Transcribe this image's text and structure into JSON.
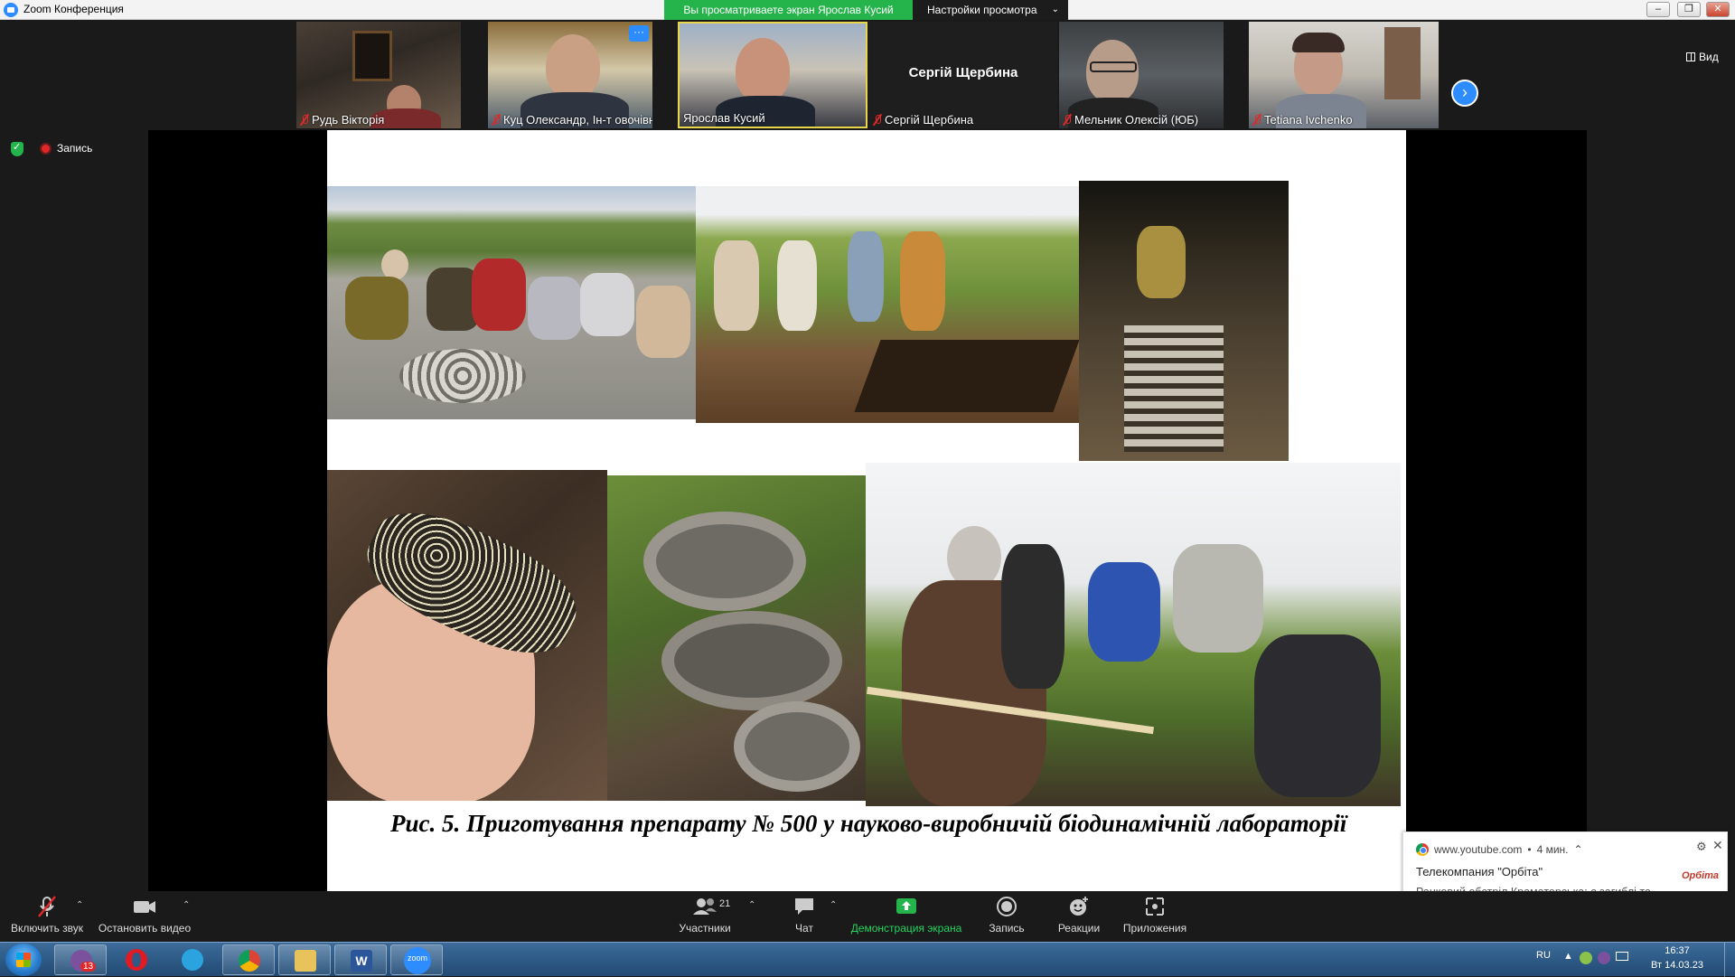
{
  "window": {
    "title": "Zoom Конференция",
    "share_banner": "Вы просматриваете экран Ярослав Кусий",
    "view_settings": "Настройки просмотра",
    "view_button": "Вид"
  },
  "participants": [
    {
      "name": "Рудь Вікторія",
      "muted": true
    },
    {
      "name": "Куц Олександр, Ін-т овочівн...",
      "muted": true
    },
    {
      "name": "Ярослав Кусий",
      "muted": false,
      "active": true
    },
    {
      "name": "Сергій Щербина",
      "muted": true,
      "display_name": "Сергій Щербина"
    },
    {
      "name": "Мельник Олексій (ЮБ)",
      "muted": true
    },
    {
      "name": "Tetiana Ivchenko",
      "muted": true
    }
  ],
  "recording": {
    "label": "Запись"
  },
  "slide": {
    "caption": "Рис. 5. Приготування препарату № 500 у науково-виробничій біодинамічній лабораторії"
  },
  "notification": {
    "source": "www.youtube.com",
    "time": "4 мин.",
    "title": "Телекомпания \"Орбіта\"",
    "body": "Ранковий обстріл Краматорська: є загиблі та поранені, поліція документує наслідки",
    "logo": "Орбіта"
  },
  "toolbar": {
    "unmute": "Включить звук",
    "stop_video": "Остановить видео",
    "participants": "Участники",
    "participants_count": "21",
    "chat": "Чат",
    "share_screen": "Демонстрация экрана",
    "record": "Запись",
    "reactions": "Реакции",
    "apps": "Приложения"
  },
  "taskbar": {
    "viber_badge": "13",
    "zoom_label": "zoom",
    "lang": "RU",
    "time": "16:37",
    "date": "Вт 14.03.23"
  },
  "colors": {
    "zoom_blue": "#2d8cff",
    "share_green": "#25b34b",
    "muted_red": "#e02828"
  }
}
